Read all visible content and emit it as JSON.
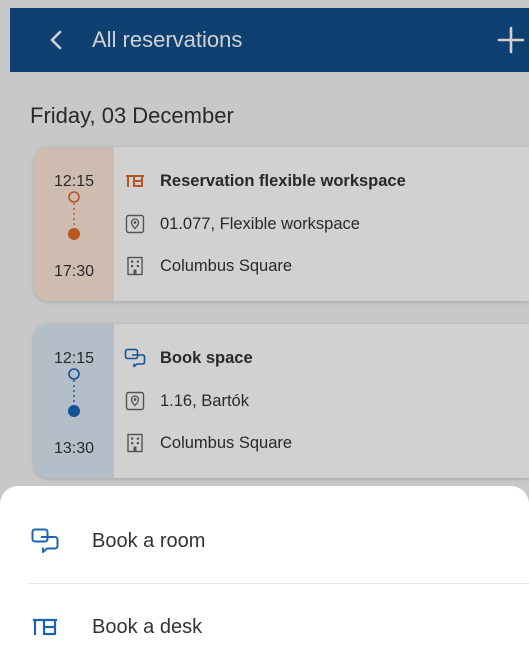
{
  "header": {
    "title": "All reservations",
    "back_icon": "chevron-left-icon",
    "add_icon": "plus-icon",
    "color": "#12508c"
  },
  "day": {
    "heading": "Friday, 03 December"
  },
  "reservations": [
    {
      "start": "12:15",
      "end": "17:30",
      "title": "Reservation flexible workspace",
      "location": "01.077, Flexible workspace",
      "building": "Columbus Square",
      "type_icon": "desk-icon",
      "accent": "#e06a2a"
    },
    {
      "start": "12:15",
      "end": "13:30",
      "title": "Book space",
      "location": "1.16, Bartók",
      "building": "Columbus Square",
      "type_icon": "chat-room-icon",
      "accent": "#1a64b4"
    }
  ],
  "sheet": {
    "items": [
      {
        "label": "Book a room",
        "icon": "chat-room-icon"
      },
      {
        "label": "Book a desk",
        "icon": "desk-icon"
      }
    ]
  }
}
